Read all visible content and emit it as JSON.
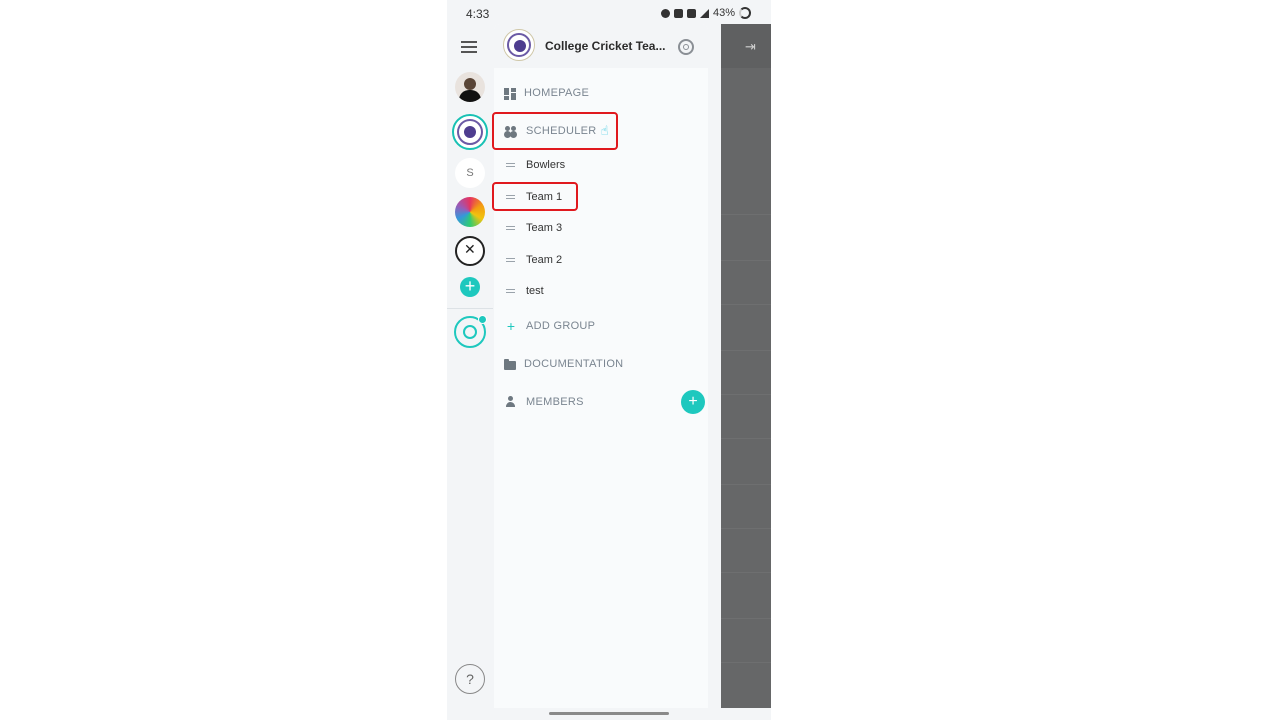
{
  "status_bar": {
    "time": "4:33",
    "battery": "43%",
    "indicators": [
      "dnd-icon",
      "vibrate-icon",
      "data-icon",
      "signal-icon",
      "battery-icon"
    ]
  },
  "rail": {
    "avatars": [
      "user-avatar",
      "college-cricket-logo",
      "s-initial-avatar",
      "colorful-logo",
      "cricket-club-logo"
    ],
    "s_initial": "S",
    "add_icon": "+",
    "help_label": "?"
  },
  "drawer": {
    "title": "College Cricket Tea...",
    "homepage": "HOMEPAGE",
    "scheduler": "SCHEDULER",
    "groups": [
      "Bowlers",
      "Team 1",
      "Team 3",
      "Team 2",
      "test"
    ],
    "add_group": "ADD GROUP",
    "documentation": "DOCUMENTATION",
    "members": "MEMBERS",
    "members_add": "+"
  },
  "colors": {
    "accent": "#1ec8be",
    "highlight": "#e0191e",
    "overlay": "#666768"
  }
}
